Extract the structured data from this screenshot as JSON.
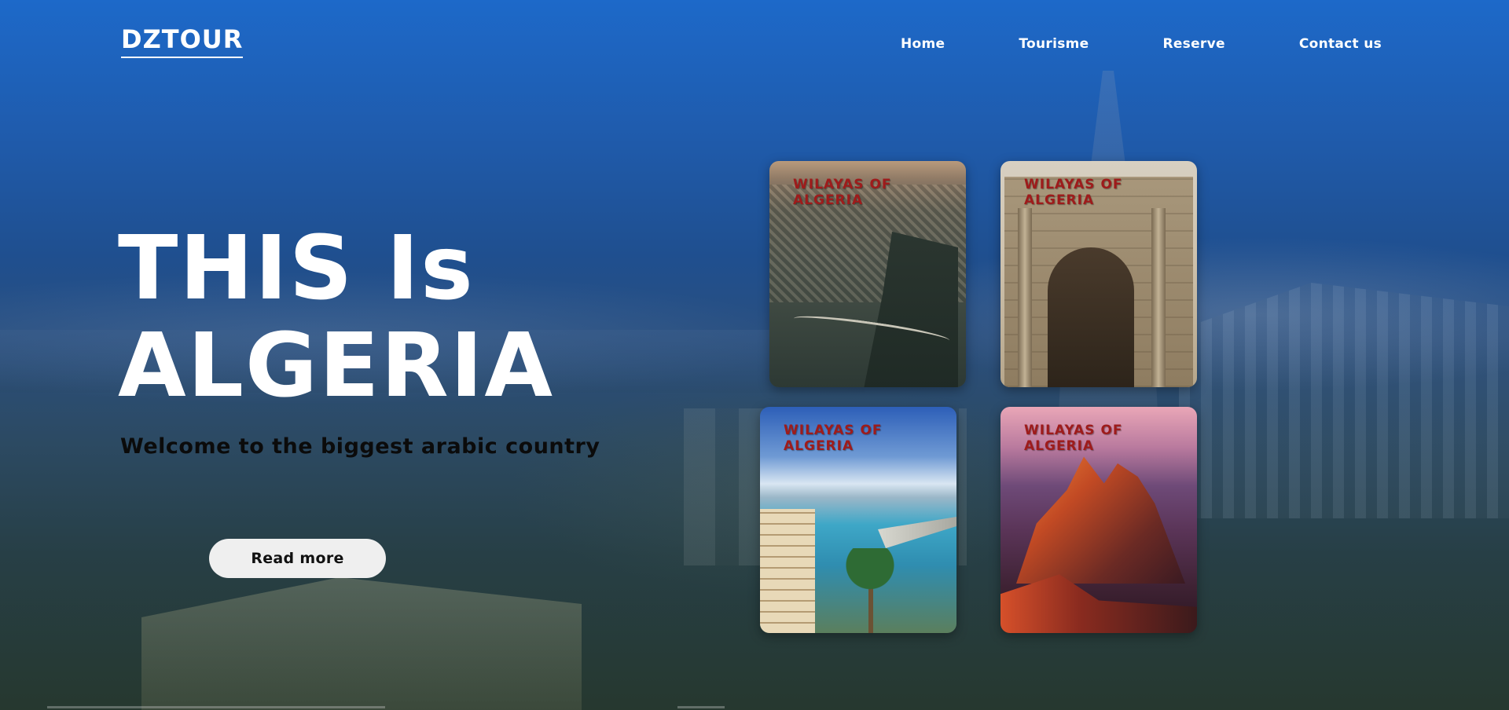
{
  "brand": {
    "logo": "DZTOUR"
  },
  "nav": {
    "items": [
      {
        "label": "Home"
      },
      {
        "label": "Tourisme"
      },
      {
        "label": "Reserve"
      },
      {
        "label": "Contact us"
      }
    ]
  },
  "hero": {
    "title_line1": "THIS Is",
    "title_line2": "ALGERIA",
    "subtitle": "Welcome to the biggest arabic country",
    "cta_label": "Read more"
  },
  "cards": [
    {
      "label": "WILAYAS OF ALGERIA",
      "image": "constantine-bridge-city"
    },
    {
      "label": "WILAYAS OF ALGERIA",
      "image": "roman-triumphal-arch"
    },
    {
      "label": "WILAYAS OF ALGERIA",
      "image": "coastal-harbor-palm"
    },
    {
      "label": "WILAYAS OF ALGERIA",
      "image": "hoggar-mountains-sunset"
    }
  ],
  "colors": {
    "background_top": "#1d69c9",
    "card_label": "#9e1b1b",
    "button_bg": "#efefef",
    "text_light": "#ffffff",
    "subtitle_text": "#0b0b0b"
  }
}
